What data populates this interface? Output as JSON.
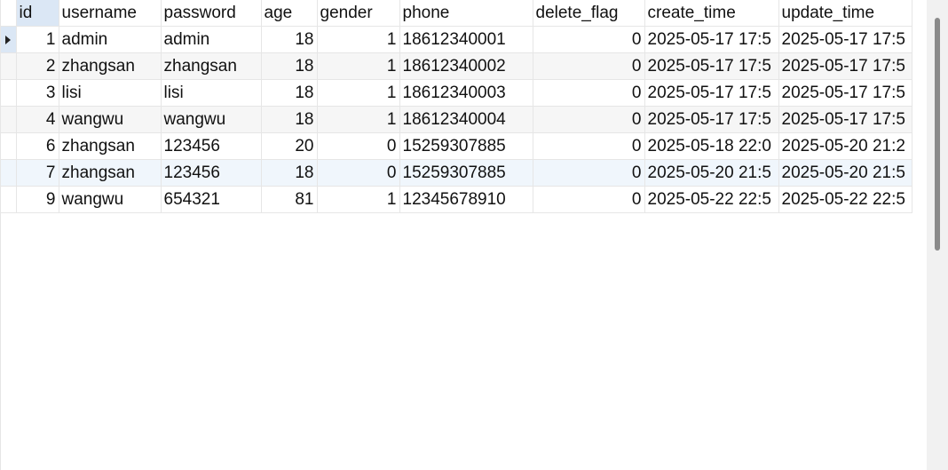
{
  "grid": {
    "columns": [
      "id",
      "username",
      "password",
      "age",
      "gender",
      "phone",
      "delete_flag",
      "create_time",
      "update_time"
    ],
    "rows": [
      {
        "id": "1",
        "username": "admin",
        "password": "admin",
        "age": "18",
        "gender": "1",
        "phone": "18612340001",
        "delete_flag": "0",
        "create_time": "2025-05-17 17:5",
        "update_time": "2025-05-17 17:5"
      },
      {
        "id": "2",
        "username": "zhangsan",
        "password": "zhangsan",
        "age": "18",
        "gender": "1",
        "phone": "18612340002",
        "delete_flag": "0",
        "create_time": "2025-05-17 17:5",
        "update_time": "2025-05-17 17:5"
      },
      {
        "id": "3",
        "username": "lisi",
        "password": "lisi",
        "age": "18",
        "gender": "1",
        "phone": "18612340003",
        "delete_flag": "0",
        "create_time": "2025-05-17 17:5",
        "update_time": "2025-05-17 17:5"
      },
      {
        "id": "4",
        "username": "wangwu",
        "password": "wangwu",
        "age": "18",
        "gender": "1",
        "phone": "18612340004",
        "delete_flag": "0",
        "create_time": "2025-05-17 17:5",
        "update_time": "2025-05-17 17:5"
      },
      {
        "id": "6",
        "username": "zhangsan",
        "password": "123456",
        "age": "20",
        "gender": "0",
        "phone": "15259307885",
        "delete_flag": "0",
        "create_time": "2025-05-18 22:0",
        "update_time": "2025-05-20 21:2"
      },
      {
        "id": "7",
        "username": "zhangsan",
        "password": "123456",
        "age": "18",
        "gender": "0",
        "phone": "15259307885",
        "delete_flag": "0",
        "create_time": "2025-05-20 21:5",
        "update_time": "2025-05-20 21:5"
      },
      {
        "id": "9",
        "username": "wangwu",
        "password": "654321",
        "age": "81",
        "gender": "1",
        "phone": "12345678910",
        "delete_flag": "0",
        "create_time": "2025-05-22 22:5",
        "update_time": "2025-05-22 22:5"
      }
    ],
    "current_row": 0,
    "hover_row": 5
  },
  "icons": {
    "row_indicator": "current-row-arrow-icon"
  }
}
